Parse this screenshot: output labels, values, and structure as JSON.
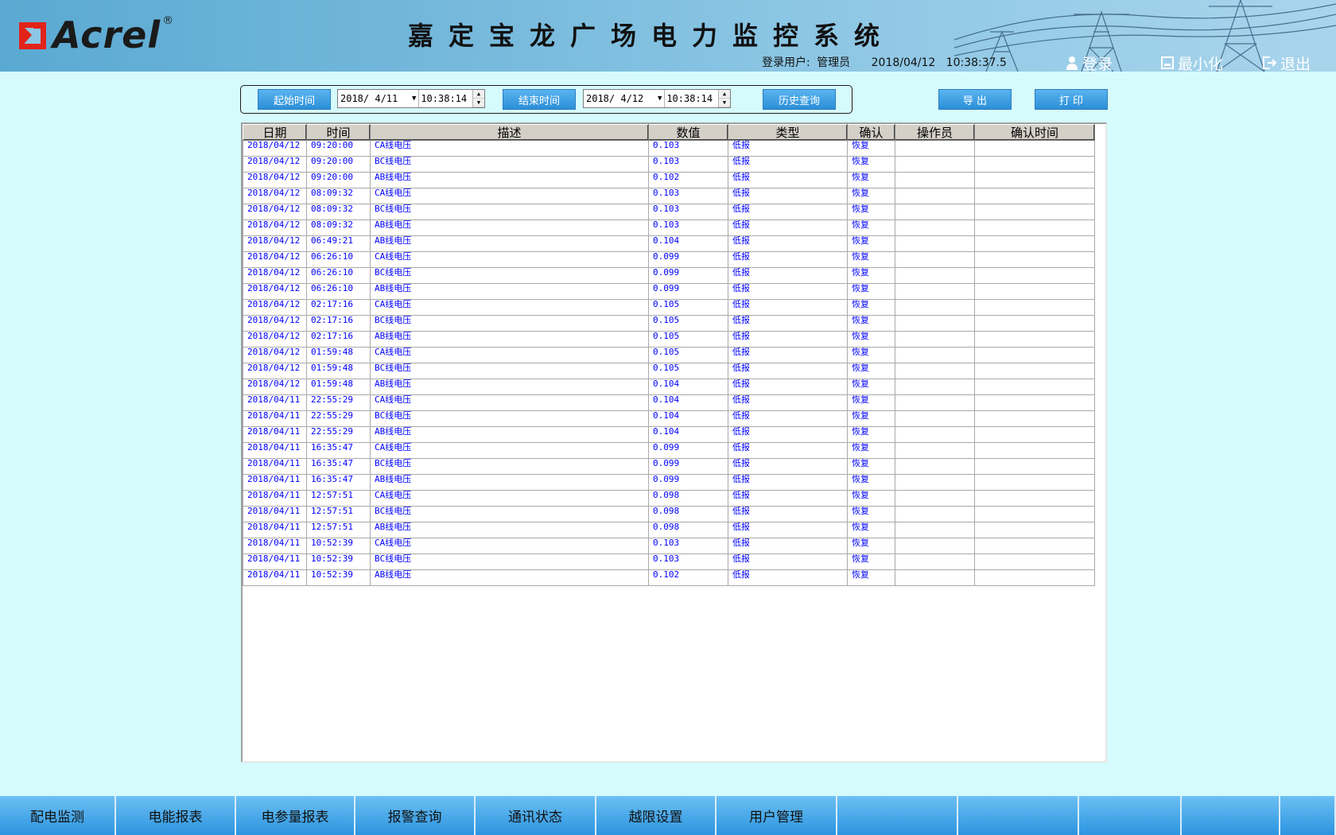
{
  "header": {
    "logo_text": "Acrel",
    "logo_reg": "®",
    "title": "嘉定宝龙广场电力监控系统",
    "login_label": "登录用户:",
    "login_user": "管理员",
    "datetime": "2018/04/12   10:38:37.5",
    "login_btn": "登录",
    "minimize_btn": "最小化",
    "exit_btn": "退出"
  },
  "query": {
    "start_label": "起始时间",
    "start_date": "2018/ 4/11",
    "start_time": "10:38:14",
    "end_label": "结束时间",
    "end_date": "2018/ 4/12",
    "end_time": "10:38:14",
    "history_btn": "历史查询",
    "export_btn": "导 出",
    "print_btn": "打 印"
  },
  "table": {
    "columns": [
      "日期",
      "时间",
      "描述",
      "数值",
      "类型",
      "确认",
      "操作员",
      "确认时间"
    ],
    "rows": [
      [
        "2018/04/12",
        "09:20:00",
        "CA线电压",
        "0.103",
        "低报",
        "恢复",
        "",
        ""
      ],
      [
        "2018/04/12",
        "09:20:00",
        "BC线电压",
        "0.103",
        "低报",
        "恢复",
        "",
        ""
      ],
      [
        "2018/04/12",
        "09:20:00",
        "AB线电压",
        "0.102",
        "低报",
        "恢复",
        "",
        ""
      ],
      [
        "2018/04/12",
        "08:09:32",
        "CA线电压",
        "0.103",
        "低报",
        "恢复",
        "",
        ""
      ],
      [
        "2018/04/12",
        "08:09:32",
        "BC线电压",
        "0.103",
        "低报",
        "恢复",
        "",
        ""
      ],
      [
        "2018/04/12",
        "08:09:32",
        "AB线电压",
        "0.103",
        "低报",
        "恢复",
        "",
        ""
      ],
      [
        "2018/04/12",
        "06:49:21",
        "AB线电压",
        "0.104",
        "低报",
        "恢复",
        "",
        ""
      ],
      [
        "2018/04/12",
        "06:26:10",
        "CA线电压",
        "0.099",
        "低报",
        "恢复",
        "",
        ""
      ],
      [
        "2018/04/12",
        "06:26:10",
        "BC线电压",
        "0.099",
        "低报",
        "恢复",
        "",
        ""
      ],
      [
        "2018/04/12",
        "06:26:10",
        "AB线电压",
        "0.099",
        "低报",
        "恢复",
        "",
        ""
      ],
      [
        "2018/04/12",
        "02:17:16",
        "CA线电压",
        "0.105",
        "低报",
        "恢复",
        "",
        ""
      ],
      [
        "2018/04/12",
        "02:17:16",
        "BC线电压",
        "0.105",
        "低报",
        "恢复",
        "",
        ""
      ],
      [
        "2018/04/12",
        "02:17:16",
        "AB线电压",
        "0.105",
        "低报",
        "恢复",
        "",
        ""
      ],
      [
        "2018/04/12",
        "01:59:48",
        "CA线电压",
        "0.105",
        "低报",
        "恢复",
        "",
        ""
      ],
      [
        "2018/04/12",
        "01:59:48",
        "BC线电压",
        "0.105",
        "低报",
        "恢复",
        "",
        ""
      ],
      [
        "2018/04/12",
        "01:59:48",
        "AB线电压",
        "0.104",
        "低报",
        "恢复",
        "",
        ""
      ],
      [
        "2018/04/11",
        "22:55:29",
        "CA线电压",
        "0.104",
        "低报",
        "恢复",
        "",
        ""
      ],
      [
        "2018/04/11",
        "22:55:29",
        "BC线电压",
        "0.104",
        "低报",
        "恢复",
        "",
        ""
      ],
      [
        "2018/04/11",
        "22:55:29",
        "AB线电压",
        "0.104",
        "低报",
        "恢复",
        "",
        ""
      ],
      [
        "2018/04/11",
        "16:35:47",
        "CA线电压",
        "0.099",
        "低报",
        "恢复",
        "",
        ""
      ],
      [
        "2018/04/11",
        "16:35:47",
        "BC线电压",
        "0.099",
        "低报",
        "恢复",
        "",
        ""
      ],
      [
        "2018/04/11",
        "16:35:47",
        "AB线电压",
        "0.099",
        "低报",
        "恢复",
        "",
        ""
      ],
      [
        "2018/04/11",
        "12:57:51",
        "CA线电压",
        "0.098",
        "低报",
        "恢复",
        "",
        ""
      ],
      [
        "2018/04/11",
        "12:57:51",
        "BC线电压",
        "0.098",
        "低报",
        "恢复",
        "",
        ""
      ],
      [
        "2018/04/11",
        "12:57:51",
        "AB线电压",
        "0.098",
        "低报",
        "恢复",
        "",
        ""
      ],
      [
        "2018/04/11",
        "10:52:39",
        "CA线电压",
        "0.103",
        "低报",
        "恢复",
        "",
        ""
      ],
      [
        "2018/04/11",
        "10:52:39",
        "BC线电压",
        "0.103",
        "低报",
        "恢复",
        "",
        ""
      ],
      [
        "2018/04/11",
        "10:52:39",
        "AB线电压",
        "0.102",
        "低报",
        "恢复",
        "",
        ""
      ]
    ]
  },
  "nav": {
    "items": [
      "配电监测",
      "电能报表",
      "电参量报表",
      "报警查询",
      "通讯状态",
      "越限设置",
      "用户管理",
      "",
      "",
      "",
      "",
      ""
    ]
  },
  "colors": {
    "background": "#d6fbfc",
    "header_blue": "#5aa9d2",
    "row_text": "#0000ff",
    "button_blue": "#2b8fd8",
    "logo_red": "#e2231a"
  }
}
